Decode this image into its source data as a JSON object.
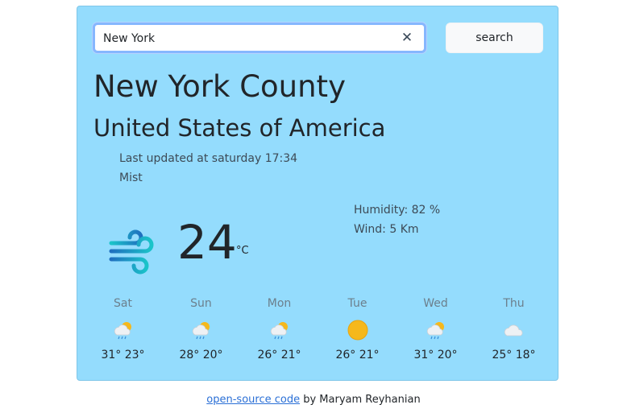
{
  "search": {
    "value": "New York",
    "placeholder": "",
    "clear_icon": "close-icon",
    "button_label": "search"
  },
  "location": {
    "city": "New York County",
    "country": "United States of America"
  },
  "current": {
    "updated": "Last updated at saturday 17:34",
    "condition": "Mist",
    "temperature": "24",
    "unit": "°C",
    "icon": "wind-icon",
    "humidity": "Humidity: 82 %",
    "wind": "Wind: 5 Km"
  },
  "forecast": [
    {
      "day": "Sat",
      "icon": "cloud-sun-rain-icon",
      "temps": "31° 23°"
    },
    {
      "day": "Sun",
      "icon": "cloud-sun-rain-icon",
      "temps": "28° 20°"
    },
    {
      "day": "Mon",
      "icon": "cloud-sun-rain-icon",
      "temps": "26° 21°"
    },
    {
      "day": "Tue",
      "icon": "sun-icon",
      "temps": "26° 21°"
    },
    {
      "day": "Wed",
      "icon": "cloud-sun-rain-icon",
      "temps": "31° 20°"
    },
    {
      "day": "Thu",
      "icon": "cloud-icon",
      "temps": "25° 18°"
    }
  ],
  "footer": {
    "link_text": "open-source code",
    "author_text": " by Maryam Reyhanian"
  },
  "colors": {
    "card_background": "#94dcfd",
    "link": "#2a6fd6",
    "input_focus_border": "#86b7fe",
    "sun": "#f5b81c",
    "wind_icon_teal": "#1bc4c9",
    "wind_icon_blue": "#1f6fbf"
  }
}
